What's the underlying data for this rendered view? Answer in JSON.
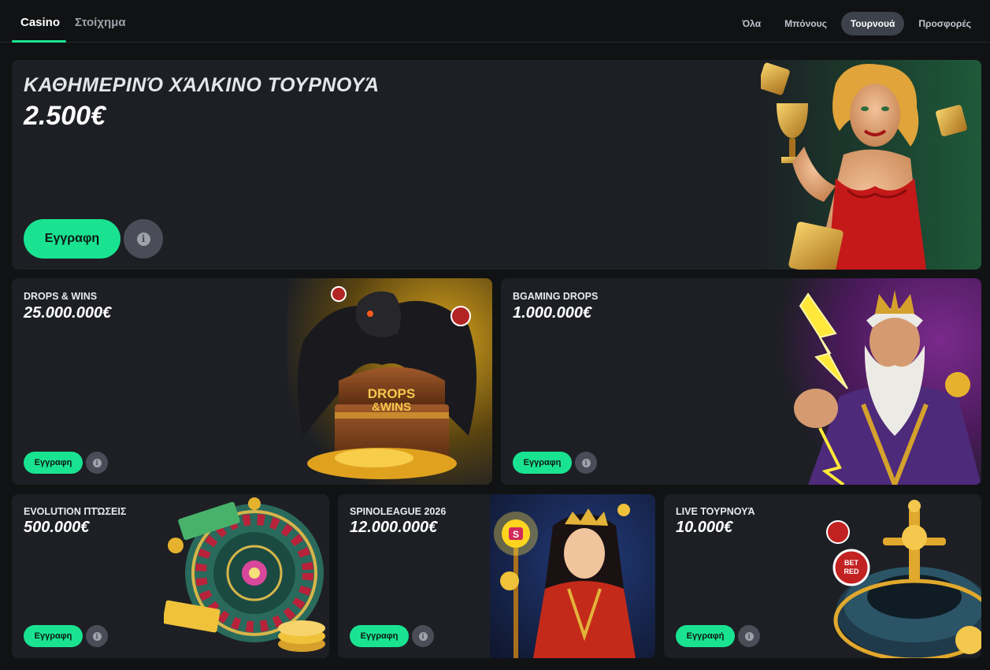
{
  "top_nav": {
    "tabs": [
      {
        "label": "Casino",
        "active": true
      },
      {
        "label": "Στοίχημα",
        "active": false
      }
    ],
    "filters": [
      {
        "label": "Όλα",
        "active": false
      },
      {
        "label": "Μπόνους",
        "active": false
      },
      {
        "label": "Τουρνουά",
        "active": true
      },
      {
        "label": "Προσφορές",
        "active": false
      }
    ]
  },
  "colors": {
    "accent": "#19e391",
    "card_bg": "#1d1f24",
    "page_bg": "#111214"
  },
  "tournaments": [
    {
      "title": "ΚΑΘΗΜΕΡΙΝΌ ΧΆΛΚΙΝΟ ΤΟΥΡΝΟΥΆ",
      "amount": "2.500€",
      "register_label": "Εγγραφη",
      "info_icon": "info-icon",
      "art": "golden-woman-with-trophy"
    },
    {
      "title": "DROPS & WINS",
      "amount": "25.000.000€",
      "register_label": "Εγγραφη",
      "info_icon": "info-icon",
      "art": "dragon-treasure-chest"
    },
    {
      "title": "BGAMING DROPS",
      "amount": "1.000.000€",
      "register_label": "Εγγραφη",
      "info_icon": "info-icon",
      "art": "zeus-lightning"
    },
    {
      "title": "EVOLUTION ΠΤΏΣΕΙΣ",
      "amount": "500.000€",
      "register_label": "Εγγραφη",
      "info_icon": "info-icon",
      "art": "roulette-wheel"
    },
    {
      "title": "SPINOLEAGUE 2026",
      "amount": "12.000.000€",
      "register_label": "Εγγραφη",
      "info_icon": "info-icon",
      "art": "warrior-princess"
    },
    {
      "title": "LIVE ΤΟΥΡΝΟΥΆ",
      "amount": "10.000€",
      "register_label": "Εγγραφή",
      "info_icon": "info-icon",
      "art": "golden-roulette"
    }
  ]
}
